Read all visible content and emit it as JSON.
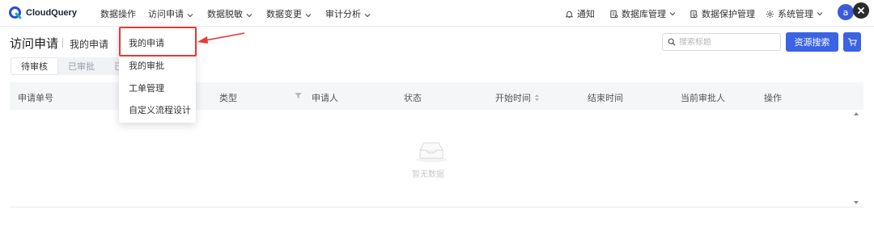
{
  "app": {
    "name": "CloudQuery",
    "avatar_letter": "a",
    "accent_color": "#3b63e4"
  },
  "nav": {
    "items": [
      {
        "label": "数据操作",
        "has_caret": false
      },
      {
        "label": "访问申请",
        "has_caret": true
      },
      {
        "label": "数据脱敏",
        "has_caret": true
      },
      {
        "label": "数据变更",
        "has_caret": true
      },
      {
        "label": "审计分析",
        "has_caret": true
      }
    ],
    "right": [
      {
        "label": "通知",
        "icon": "bell-icon"
      },
      {
        "label": "数据库管理",
        "icon": "database-icon",
        "has_caret": true
      },
      {
        "label": "数据保护管理",
        "icon": "shield-doc-icon"
      },
      {
        "label": "系统管理",
        "icon": "gear-icon",
        "has_caret": true
      }
    ]
  },
  "page": {
    "title": "访问申请",
    "subtitle": "我的申请",
    "search_placeholder": "搜索标题",
    "primary_button": "资源搜索",
    "tabs": [
      "待审核",
      "已审批",
      "已"
    ]
  },
  "dropdown": {
    "items": [
      "我的申请",
      "我的审批",
      "工单管理",
      "自定义流程设计"
    ],
    "highlighted_color": "#e53935"
  },
  "table": {
    "columns": [
      "申请单号",
      "类型",
      "申请人",
      "状态",
      "开始时间",
      "结束时间",
      "当前审批人",
      "操作"
    ],
    "empty_text": "暂无数据"
  }
}
